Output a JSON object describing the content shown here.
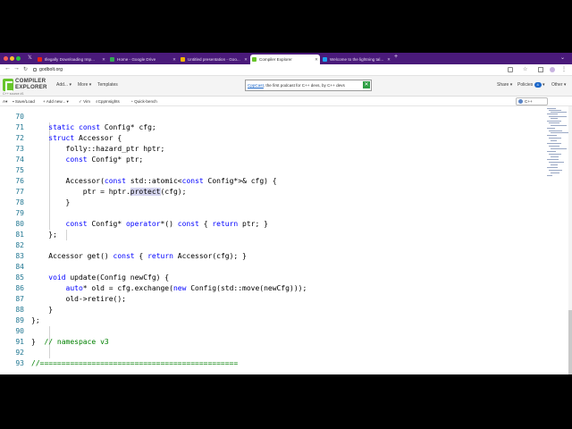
{
  "tabs": [
    {
      "label": "Illegally Downloading Imp...",
      "favicon_color": "#e62117"
    },
    {
      "label": "Home - Google Drive",
      "favicon_color": "#34a853"
    },
    {
      "label": "Untitled presentation - Goo...",
      "favicon_color": "#f4b400"
    },
    {
      "label": "Compiler Explorer",
      "favicon_color": "#67c52a",
      "active": true
    },
    {
      "label": "Welcome to the lightning tal...",
      "favicon_color": "#1da1f2"
    }
  ],
  "address": {
    "url": "godbolt.org"
  },
  "header": {
    "logo_line1": "COMPILER",
    "logo_line2": "EXPLORER",
    "subtitle": "C++ source #1",
    "menu": {
      "add": "Add...",
      "more": "More",
      "templates": "Templates"
    },
    "sponsor": {
      "link": "CppCast",
      "text": ", the first podcast for C++ devs, by C++ devs"
    },
    "right": {
      "share": "Share",
      "policies": "Policies",
      "policies_count": "4",
      "other": "Other"
    }
  },
  "editor_toolbar": {
    "font": "A",
    "save": "Save/Load",
    "add_new": "Add new...",
    "vim": "Vim",
    "cppinsights": "CppInsights",
    "quickbench": "Quick-bench",
    "language": "C++"
  },
  "editor": {
    "lines": [
      {
        "n": "70",
        "code": "    static const Config* cfg;",
        "partial": true
      },
      {
        "n": "71",
        "code": "    struct Accessor {"
      },
      {
        "n": "72",
        "code": "        folly::hazard_ptr hptr;"
      },
      {
        "n": "73",
        "code": "        const Config* ptr;"
      },
      {
        "n": "74",
        "code": ""
      },
      {
        "n": "75",
        "code": "        Accessor(const std::atomic<const Config*>& cfg) {"
      },
      {
        "n": "76",
        "code": "            ptr = hptr.protect(cfg);"
      },
      {
        "n": "77",
        "code": "        }"
      },
      {
        "n": "78",
        "code": ""
      },
      {
        "n": "79",
        "code": "        const Config* operator*() const { return ptr; }"
      },
      {
        "n": "80",
        "code": "    };"
      },
      {
        "n": "81",
        "code": ""
      },
      {
        "n": "82",
        "code": "    Accessor get() const { return Accessor(cfg); }"
      },
      {
        "n": "83",
        "code": ""
      },
      {
        "n": "84",
        "code": "    void update(Config newCfg) {"
      },
      {
        "n": "85",
        "code": "        auto* old = cfg.exchange(new Config(std::move(newCfg)));"
      },
      {
        "n": "86",
        "code": "        old->retire();"
      },
      {
        "n": "87",
        "code": "    }"
      },
      {
        "n": "88",
        "code": "};"
      },
      {
        "n": "89",
        "code": ""
      },
      {
        "n": "90",
        "code": "}  // namespace v3"
      },
      {
        "n": "91",
        "code": ""
      },
      {
        "n": "92",
        "code": "//=============================================="
      },
      {
        "n": "93",
        "code": ""
      }
    ]
  }
}
